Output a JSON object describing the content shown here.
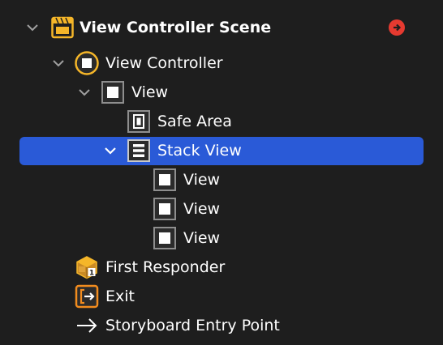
{
  "colors": {
    "background": "#1e1e1e",
    "selection": "#2a5ad7",
    "text": "#ffffff",
    "chevron": "#a0a0a0",
    "scene_icon": "#f5b629",
    "controller_icon": "#f5b629",
    "exit_icon": "#f28c1e",
    "warning": "#e63a30"
  },
  "outline": {
    "scene": {
      "label": "View Controller Scene",
      "icon": "scene-icon",
      "expanded": true,
      "warning_icon": "arrow-right-circle-icon"
    },
    "view_controller": {
      "label": "View Controller",
      "icon": "view-controller-icon",
      "expanded": true
    },
    "view": {
      "label": "View",
      "icon": "view-icon",
      "expanded": true
    },
    "safe_area": {
      "label": "Safe Area",
      "icon": "safe-area-icon"
    },
    "stack_view": {
      "label": "Stack View",
      "icon": "stack-view-icon",
      "expanded": true,
      "selected": true
    },
    "stack_children": [
      {
        "label": "View",
        "icon": "view-icon"
      },
      {
        "label": "View",
        "icon": "view-icon"
      },
      {
        "label": "View",
        "icon": "view-icon"
      }
    ],
    "first_responder": {
      "label": "First Responder",
      "icon": "first-responder-icon"
    },
    "exit": {
      "label": "Exit",
      "icon": "exit-icon"
    },
    "entry_point": {
      "label": "Storyboard Entry Point",
      "icon": "arrow-right-icon"
    }
  }
}
